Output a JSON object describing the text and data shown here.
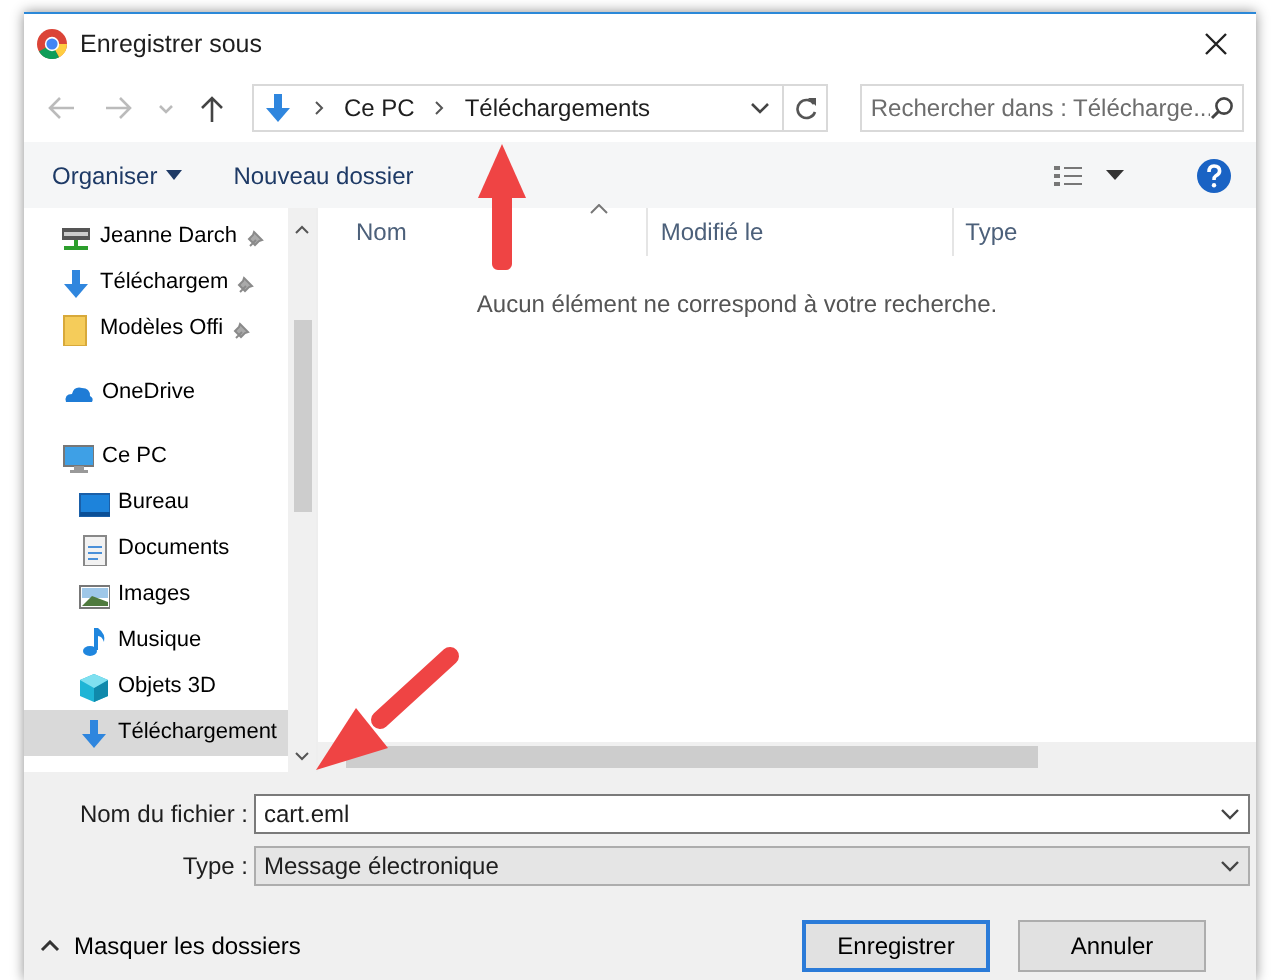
{
  "window": {
    "title": "Enregistrer sous"
  },
  "address": {
    "crumbs": [
      "Ce PC",
      "Téléchargements"
    ]
  },
  "search": {
    "placeholder": "Rechercher dans : Télécharge..."
  },
  "toolbar": {
    "organize": "Organiser",
    "new_folder": "Nouveau dossier"
  },
  "sidebar": {
    "items": [
      {
        "label": "Jeanne Darch",
        "kind": "network",
        "pinned": true,
        "selected": false
      },
      {
        "label": "Téléchargem",
        "kind": "download",
        "pinned": true,
        "selected": false
      },
      {
        "label": "Modèles Offi",
        "kind": "folder",
        "pinned": true,
        "selected": false
      },
      {
        "label": "OneDrive",
        "kind": "cloud",
        "pinned": false,
        "selected": false
      },
      {
        "label": "Ce PC",
        "kind": "pc",
        "pinned": false,
        "selected": false,
        "children": [
          {
            "label": "Bureau",
            "kind": "desktop",
            "pinned": false,
            "selected": false
          },
          {
            "label": "Documents",
            "kind": "document",
            "pinned": false,
            "selected": false
          },
          {
            "label": "Images",
            "kind": "image",
            "pinned": false,
            "selected": false
          },
          {
            "label": "Musique",
            "kind": "music",
            "pinned": false,
            "selected": false
          },
          {
            "label": "Objets 3D",
            "kind": "cube",
            "pinned": false,
            "selected": false
          },
          {
            "label": "Téléchargement",
            "kind": "download",
            "pinned": false,
            "selected": true
          }
        ]
      }
    ]
  },
  "columns": [
    {
      "label": "Nom",
      "sorted": true
    },
    {
      "label": "Modifié le",
      "sorted": false
    },
    {
      "label": "Type",
      "sorted": false
    }
  ],
  "empty_message": "Aucun élément ne correspond à votre recherche.",
  "form": {
    "filename_label": "Nom du fichier :",
    "filename": "cart.eml",
    "type_label": "Type :",
    "type": "Message électronique"
  },
  "hide_folders": "Masquer les dossiers",
  "buttons": [
    {
      "label": "Enregistrer",
      "default": true
    },
    {
      "label": "Annuler",
      "default": false
    }
  ]
}
